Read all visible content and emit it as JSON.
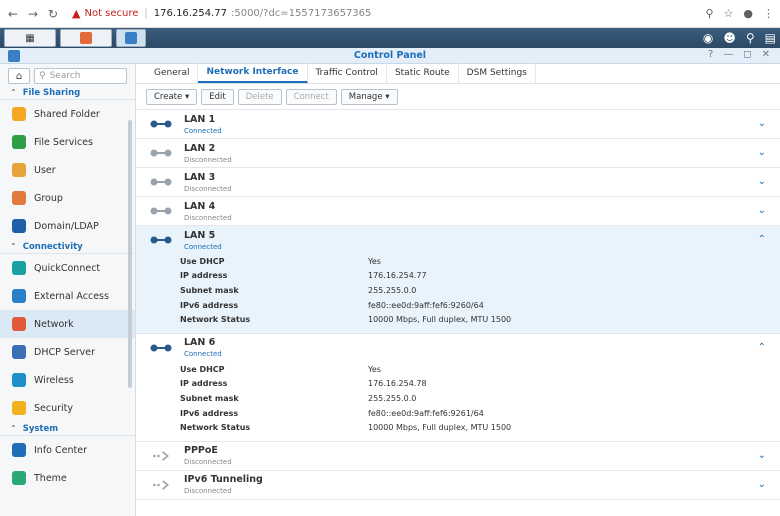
{
  "browser": {
    "security_label": "Not secure",
    "url_host": "176.16.254.77",
    "url_rest": ":5000/?dc=1557173657365"
  },
  "window": {
    "title": "Control Panel"
  },
  "sidebar": {
    "search_placeholder": "Search",
    "sections": [
      {
        "title": "File Sharing",
        "items": [
          {
            "label": "Shared Folder",
            "icon": "shared-folder-icon",
            "color": "#f5a623"
          },
          {
            "label": "File Services",
            "icon": "file-services-icon",
            "color": "#2f9e44"
          },
          {
            "label": "User",
            "icon": "user-icon",
            "color": "#e8a33c"
          },
          {
            "label": "Group",
            "icon": "group-icon",
            "color": "#e07b3c"
          },
          {
            "label": "Domain/LDAP",
            "icon": "domain-icon",
            "color": "#1e5fa8"
          }
        ]
      },
      {
        "title": "Connectivity",
        "items": [
          {
            "label": "QuickConnect",
            "icon": "quickconnect-icon",
            "color": "#19a0a0"
          },
          {
            "label": "External Access",
            "icon": "external-access-icon",
            "color": "#2a7fc9"
          },
          {
            "label": "Network",
            "icon": "network-icon",
            "color": "#e05a3a"
          },
          {
            "label": "DHCP Server",
            "icon": "dhcp-icon",
            "color": "#3a6fb5"
          },
          {
            "label": "Wireless",
            "icon": "wireless-icon",
            "color": "#1e8fc9"
          },
          {
            "label": "Security",
            "icon": "security-icon",
            "color": "#f2b21c"
          }
        ]
      },
      {
        "title": "System",
        "items": [
          {
            "label": "Info Center",
            "icon": "info-icon",
            "color": "#1e6fb7"
          },
          {
            "label": "Theme",
            "icon": "theme-icon",
            "color": "#2aa876"
          }
        ]
      }
    ]
  },
  "tabs": [
    "General",
    "Network Interface",
    "Traffic Control",
    "Static Route",
    "DSM Settings"
  ],
  "toolbar": {
    "create": "Create",
    "edit": "Edit",
    "delete": "Delete",
    "connect": "Connect",
    "manage": "Manage"
  },
  "detail_keys": {
    "dhcp": "Use DHCP",
    "ip": "IP address",
    "mask": "Subnet mask",
    "ipv6": "IPv6 address",
    "status": "Network Status"
  },
  "interfaces": [
    {
      "name": "LAN 1",
      "status": "Connected"
    },
    {
      "name": "LAN 2",
      "status": "Disconnected"
    },
    {
      "name": "LAN 3",
      "status": "Disconnected"
    },
    {
      "name": "LAN 4",
      "status": "Disconnected"
    },
    {
      "name": "LAN 5",
      "status": "Connected",
      "dhcp": "Yes",
      "ip": "176.16.254.77",
      "mask": "255.255.0.0",
      "ipv6": "fe80::ee0d:9aff:fef6:9260/64",
      "net_status": "10000 Mbps, Full duplex, MTU 1500"
    },
    {
      "name": "LAN 6",
      "status": "Connected",
      "dhcp": "Yes",
      "ip": "176.16.254.78",
      "mask": "255.255.0.0",
      "ipv6": "fe80::ee0d:9aff:fef6:9261/64",
      "net_status": "10000 Mbps, Full duplex, MTU 1500"
    },
    {
      "name": "PPPoE",
      "status": "Disconnected"
    },
    {
      "name": "IPv6 Tunneling",
      "status": "Disconnected"
    }
  ]
}
